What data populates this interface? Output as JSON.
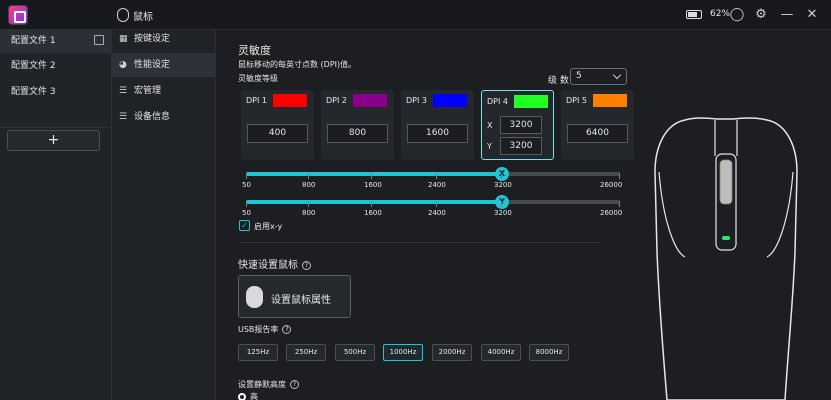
{
  "titlebar": {
    "tab_label": "鼠标",
    "battery_percent": "62%"
  },
  "profiles": {
    "items": [
      {
        "label": "配置文件 1",
        "active": true
      },
      {
        "label": "配置文件 2",
        "active": false
      },
      {
        "label": "配置文件 3",
        "active": false
      }
    ],
    "add_label": "+"
  },
  "menu": {
    "items": [
      {
        "label": "按键设定",
        "icon": "keys-icon",
        "active": false
      },
      {
        "label": "性能设定",
        "icon": "performance-icon",
        "active": true
      },
      {
        "label": "宏管理",
        "icon": "macro-icon",
        "active": false
      },
      {
        "label": "设备信息",
        "icon": "info-icon",
        "active": false
      }
    ]
  },
  "sensitivity": {
    "title": "灵敏度",
    "description": "鼠标移动的每英寸点数 (DPI)值。",
    "level_heading": "灵敏度等级",
    "level_label": "级 数",
    "level_value": "5",
    "dpi": [
      {
        "name": "DPI 1",
        "color": "#ff0000",
        "value": "400"
      },
      {
        "name": "DPI 2",
        "color": "#8b008b",
        "value": "800"
      },
      {
        "name": "DPI 3",
        "color": "#0000ff",
        "value": "1600"
      },
      {
        "name": "DPI 4",
        "color": "#22ff22",
        "x_label": "X",
        "x_value": "3200",
        "y_label": "Y",
        "y_value": "3200",
        "selected": true
      },
      {
        "name": "DPI 5",
        "color": "#ff7f00",
        "value": "6400"
      }
    ],
    "slider_x": {
      "knob_label": "X",
      "value": 3200,
      "ticks": [
        "50",
        "800",
        "1600",
        "2400",
        "3200",
        "26000"
      ]
    },
    "slider_y": {
      "knob_label": "Y",
      "value": 3200,
      "ticks": [
        "50",
        "800",
        "1600",
        "2400",
        "3200",
        "26000"
      ]
    },
    "xy_enable_label": "启用x-y",
    "xy_enabled": true
  },
  "quick": {
    "title": "快速设置鼠标",
    "button_label": "设置鼠标属性"
  },
  "usb": {
    "title": "USB报告率",
    "rates": [
      "125Hz",
      "250Hz",
      "500Hz",
      "1000Hz",
      "2000Hz",
      "4000Hz",
      "8000Hz"
    ],
    "selected": "1000Hz"
  },
  "lod": {
    "title": "设置静默高度",
    "option_label": "高"
  }
}
